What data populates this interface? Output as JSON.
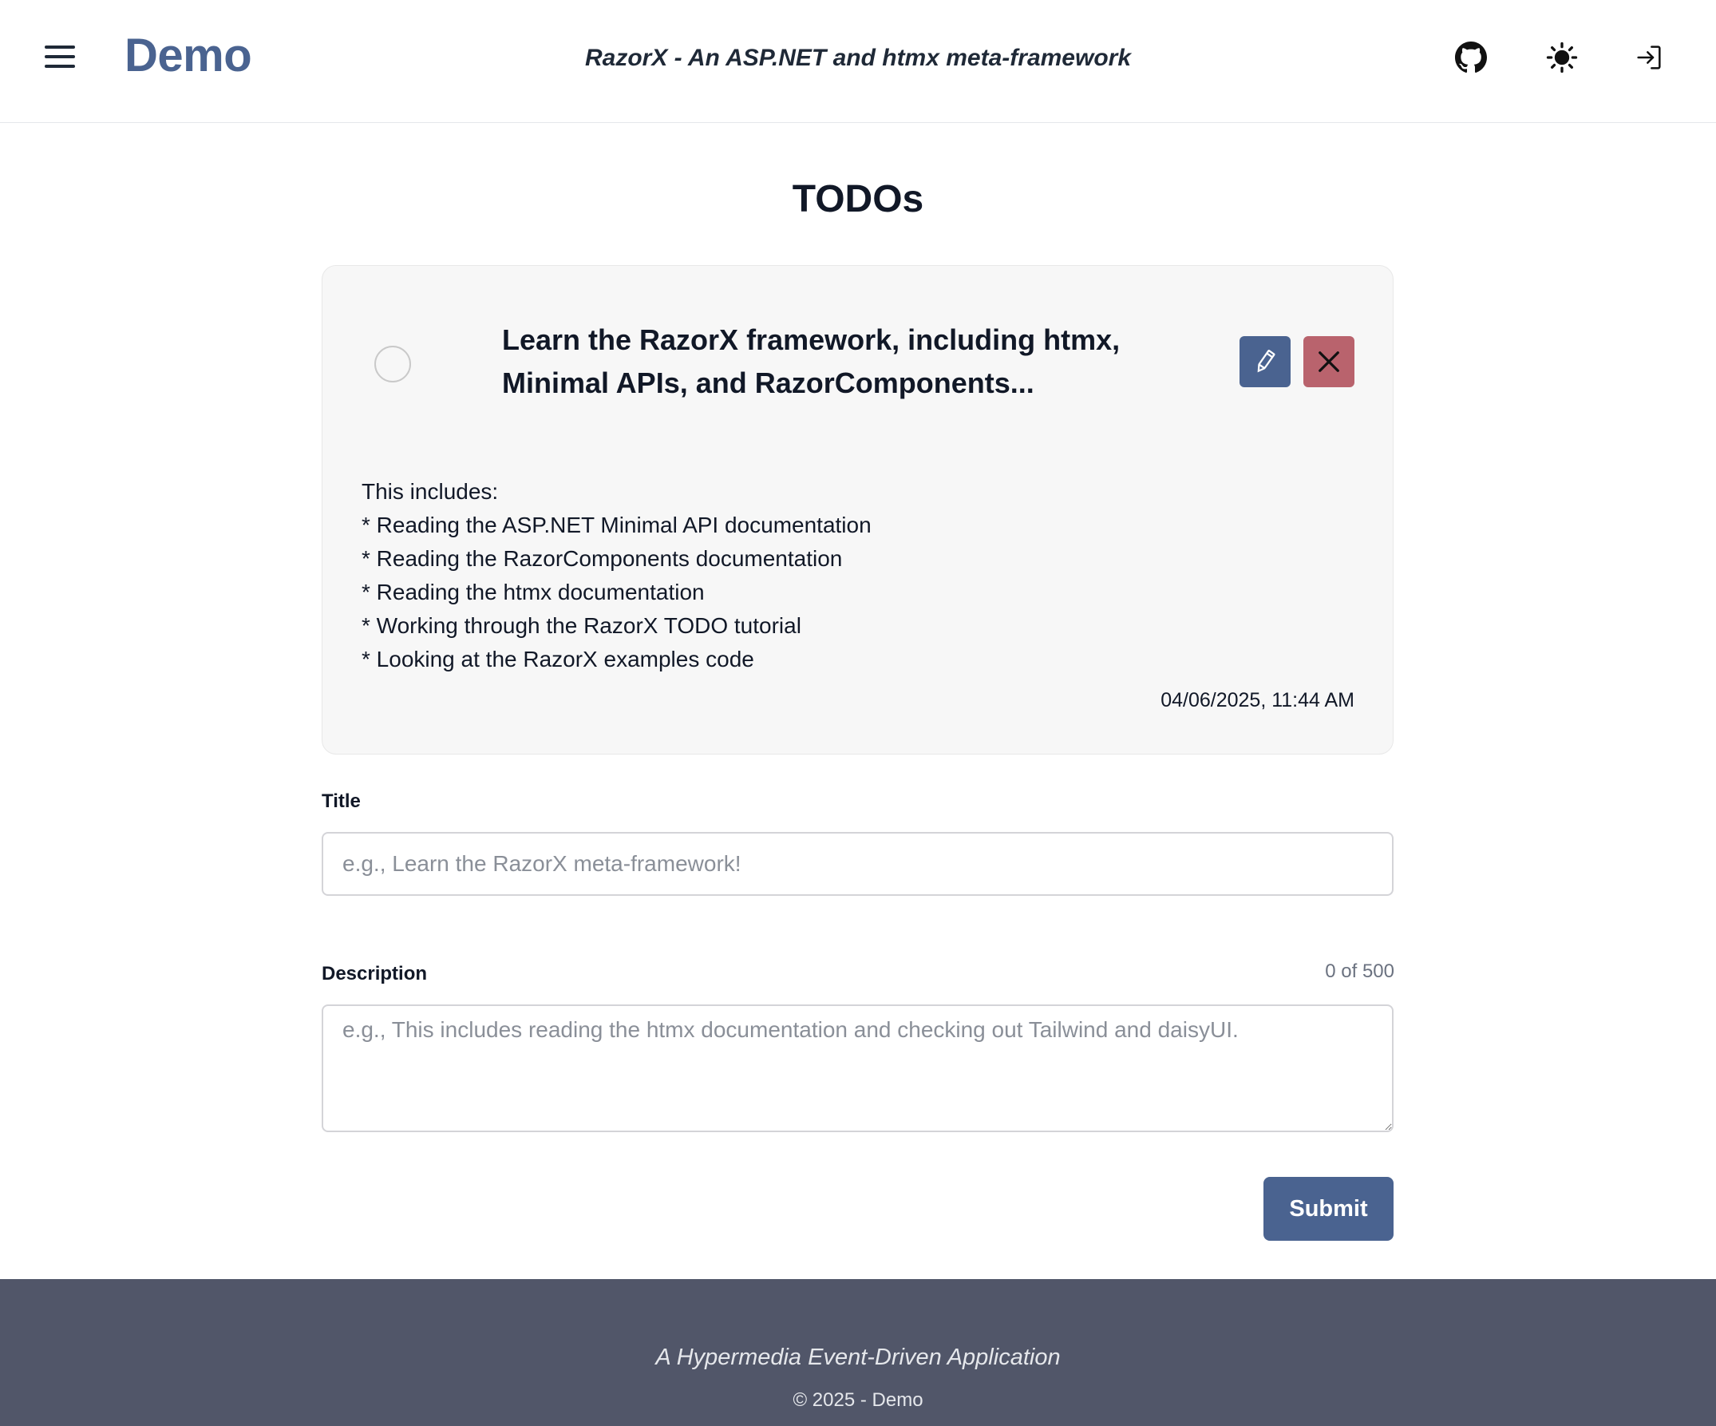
{
  "header": {
    "brand": "Demo",
    "tagline": "RazorX - An ASP.NET and htmx meta-framework",
    "icons": [
      "menu-icon",
      "github-icon",
      "sun-icon",
      "login-icon"
    ]
  },
  "main": {
    "title": "TODOs",
    "todo": {
      "completed": false,
      "title": "Learn the RazorX framework, including htmx, Minimal APIs, and RazorComponents...",
      "description_lines": [
        "This includes:",
        "* Reading the ASP.NET Minimal API documentation",
        "* Reading the RazorComponents documentation",
        "* Reading the htmx documentation",
        "* Working through the RazorX TODO tutorial",
        "* Looking at the RazorX examples code"
      ],
      "timestamp": "04/06/2025, 11:44 AM"
    },
    "form": {
      "title_label": "Title",
      "title_value": "",
      "title_placeholder": "e.g., Learn the RazorX meta-framework!",
      "description_label": "Description",
      "description_value": "",
      "description_placeholder": "e.g., This includes reading the htmx documentation and checking out Tailwind and daisyUI.",
      "counter": "0 of 500",
      "submit_label": "Submit"
    }
  },
  "footer": {
    "tagline": "A Hypermedia Event-Driven Application",
    "copyright": "© 2025 - Demo"
  },
  "colors": {
    "brand": "#4a6390",
    "delete": "#b9636d",
    "card_bg": "#f7f7f7",
    "footer_bg": "#515669"
  }
}
